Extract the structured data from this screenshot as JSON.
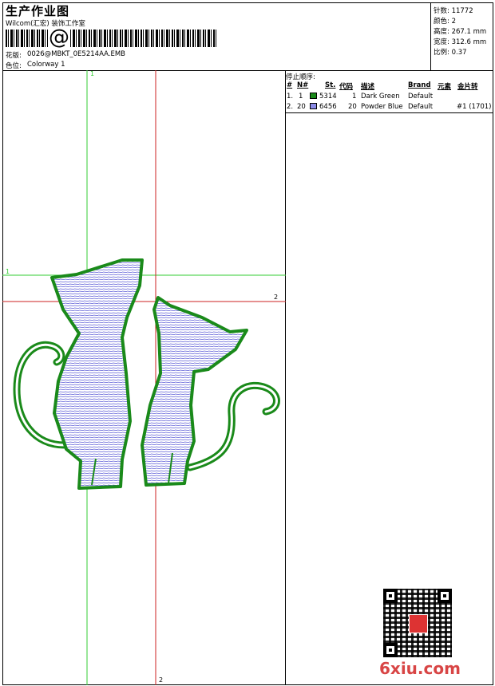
{
  "header": {
    "title": "生产作业图",
    "company": "Wilcom(汇宏) 装饰工作室",
    "design_label": "花版:",
    "design_value": "0026@MBKT_0E5214AA.EMB",
    "colorway_label": "色位:",
    "colorway_value": "Colorway 1",
    "barcode_glyph": "@"
  },
  "stats": [
    {
      "label": "针数:",
      "value": "11772"
    },
    {
      "label": "颜色:",
      "value": "2"
    },
    {
      "label": "高度:",
      "value": "267.1 mm"
    },
    {
      "label": "宽度:",
      "value": "312.6 mm"
    },
    {
      "label": "比例:",
      "value": "0.37"
    }
  ],
  "stop_sequence": {
    "title": "停止顺序:",
    "columns": [
      "#",
      "N#",
      "St.",
      "代码",
      "描述",
      "Brand",
      "元素",
      "金片转"
    ],
    "rows": [
      {
        "idx": "1.",
        "n": "1",
        "color": "#1a8a1a",
        "stitches": "5314",
        "code": "1",
        "desc": "Dark Green",
        "brand": "Default",
        "element": "",
        "sequin": ""
      },
      {
        "idx": "2.",
        "n": "20",
        "color": "#8a8ae6",
        "stitches": "6456",
        "code": "20",
        "desc": "Powder Blue",
        "brand": "Default",
        "element": "",
        "sequin": "#1 (1701)"
      }
    ]
  },
  "guides": {
    "v_green_label": "1",
    "h_green_label": "1",
    "h_red_label": "2",
    "v_red_label": "2"
  },
  "watermark": "6xiu.com",
  "colors": {
    "outline": "#1a8a1a",
    "fill_stitch": "#5a5ad6",
    "guide_green": "#33cc33",
    "guide_red": "#cc2222"
  }
}
